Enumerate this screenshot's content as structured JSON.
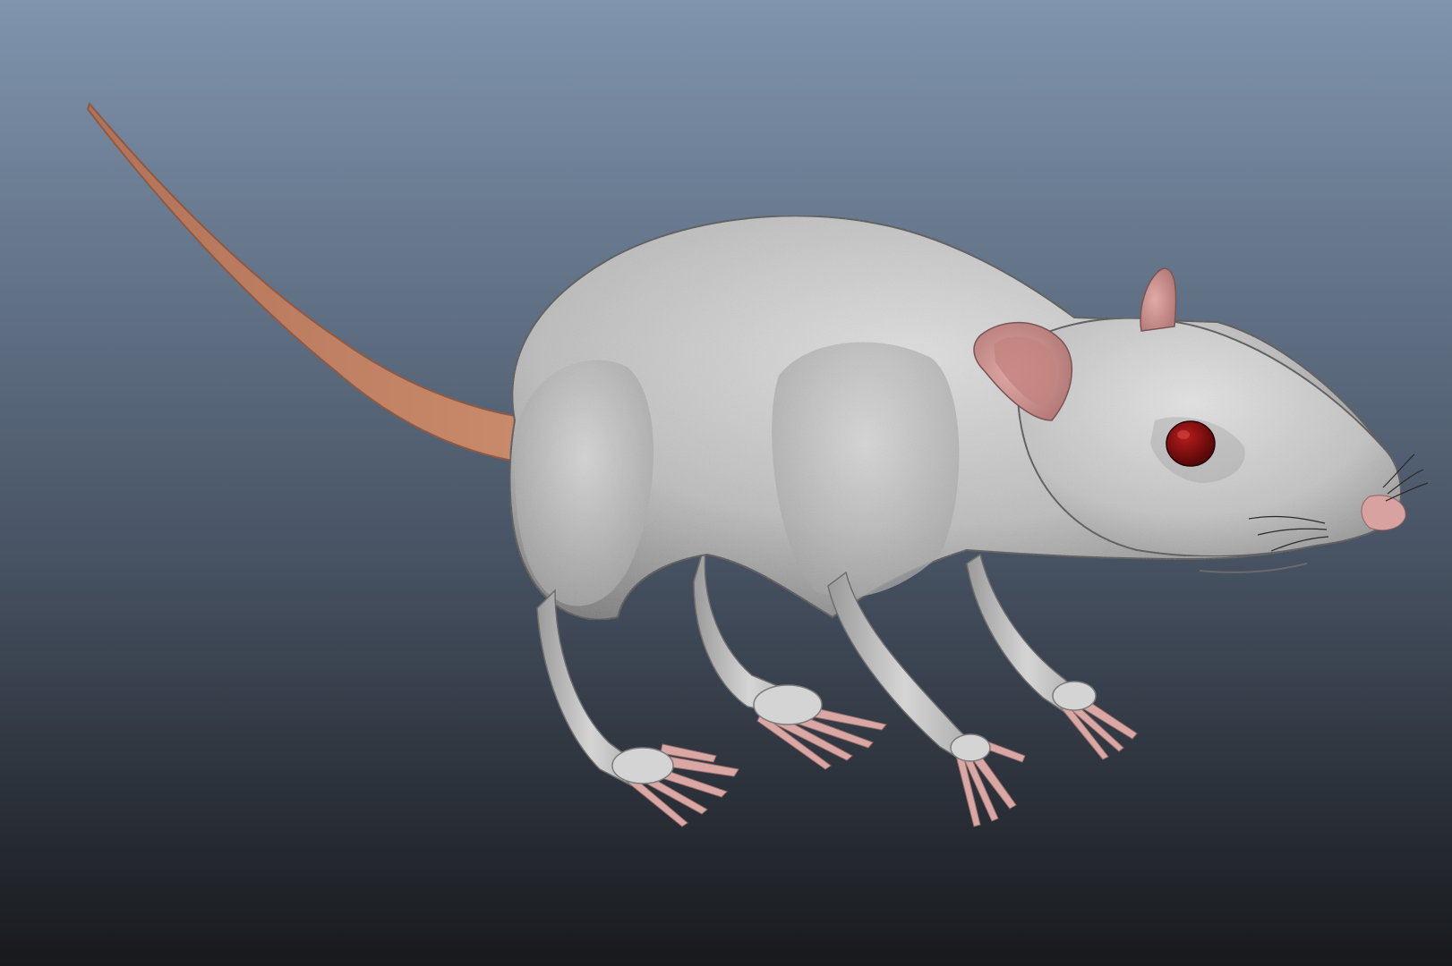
{
  "viewport": {
    "background": {
      "top_color": "#7f94ad",
      "mid_color": "#4a5667",
      "bottom_color": "#17191c"
    },
    "subject": "rat-model"
  },
  "rat_model": {
    "colors": {
      "fur_light": "#d6d6d6",
      "fur_mid": "#b4b4b4",
      "fur_dark": "#7d7d7d",
      "tail": "#c07f62",
      "tail_dark": "#8e5a43",
      "ear_inner": "#c9928f",
      "skin_pink": "#d7a2a0",
      "eye": "#7a0a0a",
      "whisker": "#2a2a2a"
    },
    "parts": [
      "tail",
      "body",
      "head",
      "left-ear",
      "right-ear",
      "eye",
      "nose",
      "whiskers",
      "front-left-leg",
      "front-right-leg",
      "hind-left-leg",
      "hind-right-leg"
    ]
  }
}
